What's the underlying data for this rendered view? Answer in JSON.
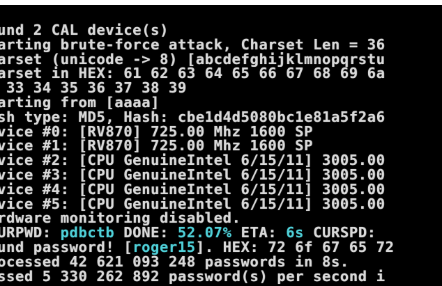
{
  "terminal": {
    "lines": [
      {
        "text": "und 2 CAL device(s)"
      },
      {
        "text": "arting brute-force attack, Charset Len = 36"
      },
      {
        "text": "arset (unicode -> 8) [abcdefghijklmnopqrstu"
      },
      {
        "text": "arset in HEX: 61 62 63 64 65 66 67 68 69 6a"
      },
      {
        "text": " 33 34 35 36 37 38 39"
      },
      {
        "text": "arting from [aaaa]"
      },
      {
        "text": "sh type: MD5, Hash: cbe1d4d5080bc1e81a5f2a6"
      },
      {
        "text": "vice #0: [RV870] 725.00 Mhz 1600 SP"
      },
      {
        "text": "vice #1: [RV870] 725.00 Mhz 1600 SP"
      },
      {
        "text": "vice #2: [CPU GenuineIntel 6/15/11] 3005.00"
      },
      {
        "text": "vice #3: [CPU GenuineIntel 6/15/11] 3005.00"
      },
      {
        "text": "vice #4: [CPU GenuineIntel 6/15/11] 3005.00"
      },
      {
        "text": "vice #5: [CPU GenuineIntel 6/15/11] 3005.00"
      },
      {
        "text": "rdware monitoring disabled."
      }
    ],
    "status_line": {
      "label_curpwd": "URPWD: ",
      "curpwd_value": "pdbctb",
      "label_done": " DONE: ",
      "done_value": "52.07%",
      "label_eta": " ETA: ",
      "eta_value": "6s",
      "label_curspd": " CURSPD: "
    },
    "found_line": {
      "prefix": "und password! [",
      "password": "roger15",
      "suffix": "]. HEX: 72 6f 67 65 72"
    },
    "processed_line": {
      "text": "ocessed 42 621 093 248 passwords in 8s."
    },
    "last_line": {
      "text": "ssed 5 330 262 892 password(s) per second i"
    }
  },
  "colors": {
    "background": "#000000",
    "text": "#d9d9d9",
    "highlight": "#4fd0d8",
    "frame": "#ffffff"
  }
}
